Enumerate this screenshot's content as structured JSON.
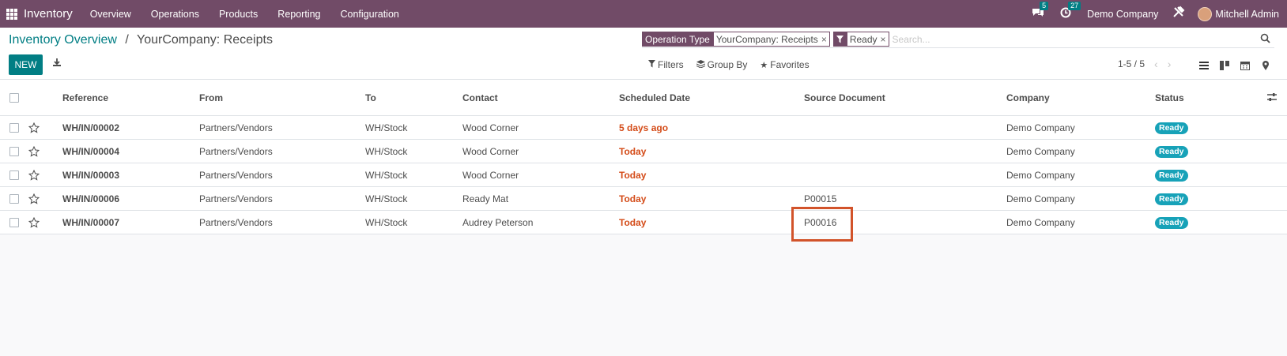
{
  "navbar": {
    "app_name": "Inventory",
    "menu": [
      "Overview",
      "Operations",
      "Products",
      "Reporting",
      "Configuration"
    ],
    "messages_count": "5",
    "activities_count": "27",
    "company": "Demo Company",
    "user": "Mitchell Admin",
    "bg_color": "#714b67"
  },
  "control": {
    "breadcrumb_parent": "Inventory Overview",
    "breadcrumb_separator": "/",
    "breadcrumb_current": "YourCompany: Receipts",
    "new_label": "NEW",
    "search": {
      "facets": [
        {
          "title": "Operation Type",
          "value": "YourCompany: Receipts"
        },
        {
          "title": "",
          "value": "Ready"
        }
      ],
      "placeholder": "Search..."
    },
    "filters_label": "Filters",
    "groupby_label": "Group By",
    "favorites_label": "Favorites",
    "pager": "1-5 / 5"
  },
  "table": {
    "columns": [
      "Reference",
      "From",
      "To",
      "Contact",
      "Scheduled Date",
      "Source Document",
      "Company",
      "Status"
    ],
    "rows": [
      {
        "reference": "WH/IN/00002",
        "from": "Partners/Vendors",
        "to": "WH/Stock",
        "contact": "Wood Corner",
        "date": "5 days ago",
        "source": "",
        "company": "Demo Company",
        "status": "Ready"
      },
      {
        "reference": "WH/IN/00004",
        "from": "Partners/Vendors",
        "to": "WH/Stock",
        "contact": "Wood Corner",
        "date": "Today",
        "source": "",
        "company": "Demo Company",
        "status": "Ready"
      },
      {
        "reference": "WH/IN/00003",
        "from": "Partners/Vendors",
        "to": "WH/Stock",
        "contact": "Wood Corner",
        "date": "Today",
        "source": "",
        "company": "Demo Company",
        "status": "Ready"
      },
      {
        "reference": "WH/IN/00006",
        "from": "Partners/Vendors",
        "to": "WH/Stock",
        "contact": "Ready Mat",
        "date": "Today",
        "source": "P00015",
        "company": "Demo Company",
        "status": "Ready"
      },
      {
        "reference": "WH/IN/00007",
        "from": "Partners/Vendors",
        "to": "WH/Stock",
        "contact": "Audrey Peterson",
        "date": "Today",
        "source": "P00016",
        "company": "Demo Company",
        "status": "Ready"
      }
    ],
    "date_color": "#d44c19",
    "status_color": "#17a2b8"
  },
  "accent_color": "#017e84",
  "highlight_color": "#d2532a"
}
